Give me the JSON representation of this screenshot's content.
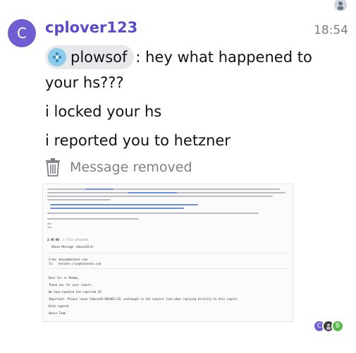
{
  "message": {
    "sender_initial": "C",
    "sender": "cplover123",
    "time": "18:54",
    "mention_name": "plowsof",
    "line1_rest": ": hey what happened to",
    "line2": "your hs???",
    "line3": "i locked your hs",
    "line4": "i reported you to hetzner",
    "removed_label": "Message removed"
  },
  "attachment": {
    "size_label": "2.48 KB",
    "attached_label": "1 file attached",
    "file_name": "Abuse Message (AbuseID:E)",
    "mail_from_label": "From:",
    "mail_from": "abuse@hetzner.com",
    "mail_to_label": "To:",
    "mail_to": "hetzner.crys@tutanota.com",
    "body_lines": [
      "Dear Sir or Madam,",
      "Thank you for your report.",
      "We have handled the reported IP.",
      "Important: Please leave [AbuseID:E0A405:23] unchanged in the subject line when replying directly to this report.",
      "Kind regards",
      "Abuse Team"
    ]
  },
  "reactions": {
    "r1": "C",
    "r3": "B"
  },
  "colors": {
    "accent": "#5a4cc8",
    "avatar": "#6d5fd1",
    "green": "#56b948"
  }
}
